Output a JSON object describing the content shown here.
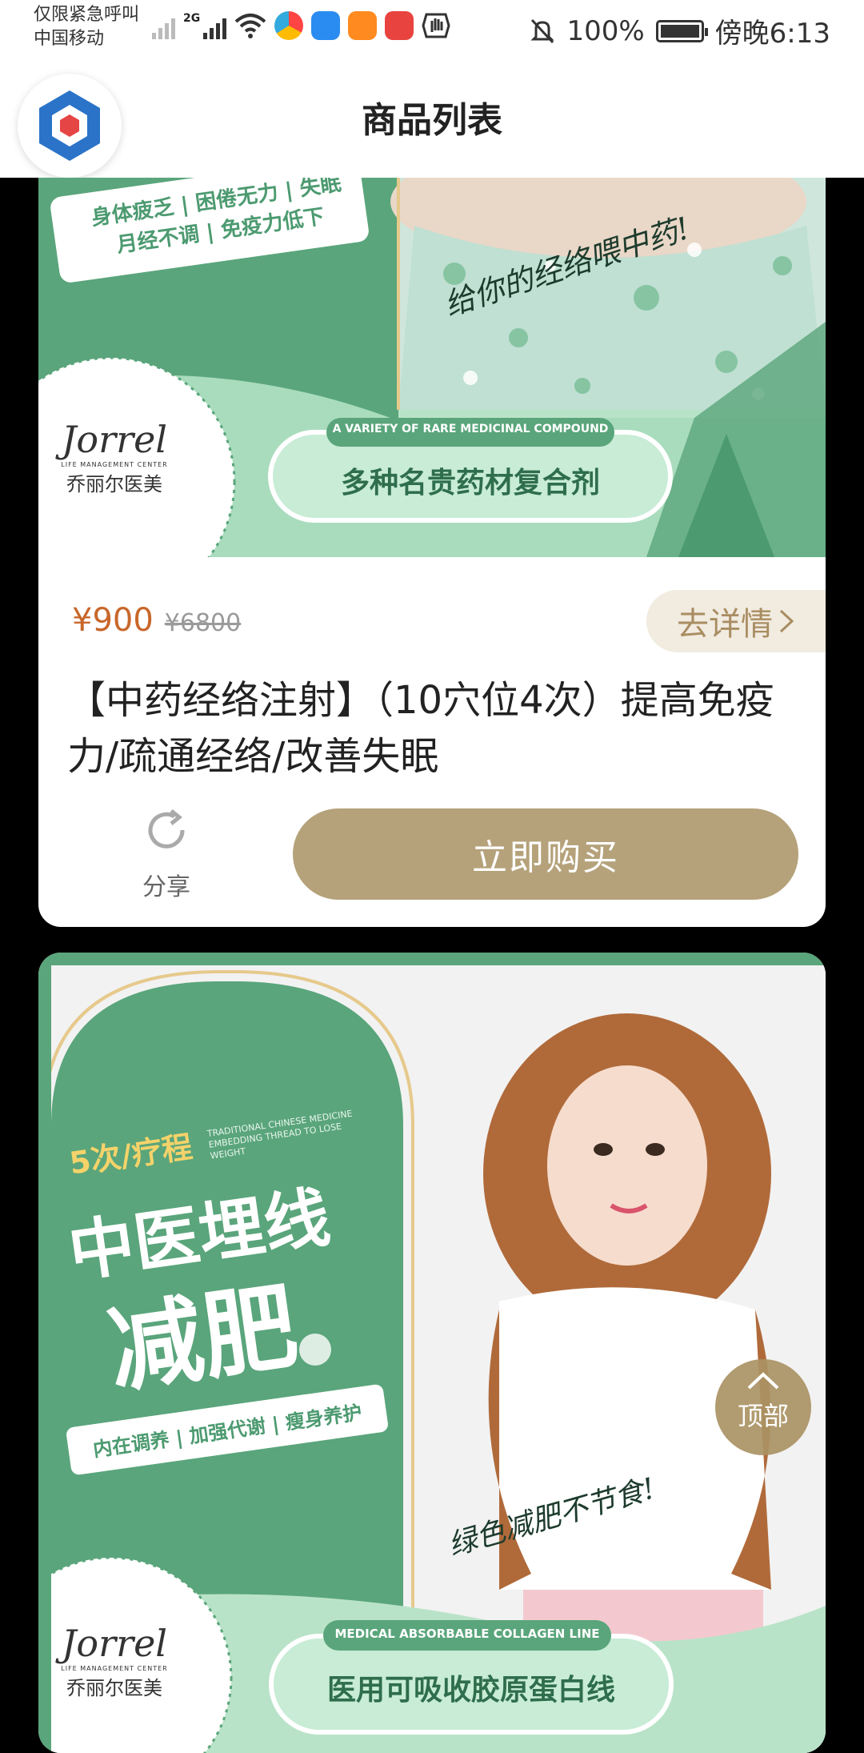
{
  "status_bar": {
    "emergency_text": "仅限紧急呼叫",
    "carrier": "中国移动",
    "network_label": "2G",
    "battery": "100%",
    "time": "傍晚6:13"
  },
  "header": {
    "title": "商品列表"
  },
  "products": [
    {
      "banner": {
        "top_tagline": "身体疲乏 | 困倦无力 | 失眠",
        "sub_tagline": "月经不调 | 免疫力低下",
        "handwriting": "给你的经络喂中药!",
        "brand_script": "Jorrel",
        "brand_small": "LIFE MANAGEMENT CENTER",
        "brand_cn": "乔丽尔医美",
        "pill_en": "A VARIETY OF RARE MEDICINAL COMPOUND",
        "pill_cn": "多种名贵药材复合剂"
      },
      "price": "¥900",
      "original_price": "¥6800",
      "detail_label": "去详情",
      "title": "【中药经络注射】（10穴位4次）提高免疫力/疏通经络/改善失眠",
      "share_label": "分享",
      "buy_label": "立即购买"
    },
    {
      "banner": {
        "course_label": "5次/疗程",
        "en_line": "TRADITIONAL CHINESE MEDICINE EMBEDDING THREAD TO LOSE WEIGHT",
        "headline_1": "中医埋线",
        "headline_2": "减肥",
        "tagline": "内在调养 | 加强代谢 | 瘦身养护",
        "handwriting": "绿色减肥不节食!",
        "brand_script": "Jorrel",
        "brand_small": "LIFE MANAGEMENT CENTER",
        "brand_cn": "乔丽尔医美",
        "pill_en": "MEDICAL ABSORBABLE COLLAGEN LINE",
        "pill_cn": "医用可吸收胶原蛋白线"
      }
    }
  ],
  "back_to_top": {
    "label": "顶部"
  },
  "colors": {
    "accent_gold": "#b5a27b",
    "price_orange": "#c8672a",
    "banner_green": "#5aa57b",
    "banner_light_green": "#b9e3c8"
  }
}
